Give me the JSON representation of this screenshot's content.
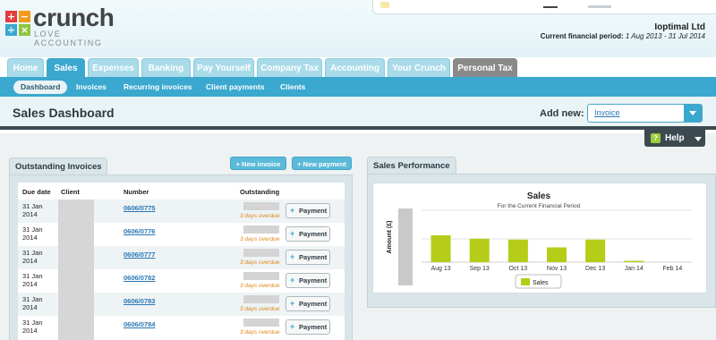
{
  "brand": {
    "logo_glyphs": [
      "+",
      "−",
      "÷",
      "×"
    ],
    "name": "crunch",
    "tagline": "LOVE ACCOUNTING",
    "colors": {
      "primary": "#3aa8cf",
      "red": "#e23c3c",
      "orange": "#f39a1d",
      "green": "#8cc63f"
    }
  },
  "account": {
    "company": "Ioptimal Ltd",
    "period_label": "Current financial period:",
    "period_value": "1 Aug 2013 - 31 Jul 2014"
  },
  "mainnav": {
    "tabs": [
      {
        "label": "Home"
      },
      {
        "label": "Sales",
        "active": true
      },
      {
        "label": "Expenses"
      },
      {
        "label": "Banking"
      },
      {
        "label": "Pay Yourself"
      },
      {
        "label": "Company Tax"
      },
      {
        "label": "Accounting"
      },
      {
        "label": "Your Crunch"
      },
      {
        "label": "Personal Tax"
      }
    ]
  },
  "subnav": {
    "items": [
      {
        "label": "Dashboard",
        "active": true
      },
      {
        "label": "Invoices"
      },
      {
        "label": "Recurring invoices"
      },
      {
        "label": "Client payments"
      },
      {
        "label": "Clients"
      }
    ]
  },
  "titlebar": {
    "title": "Sales Dashboard",
    "add_new_label": "Add new:",
    "add_new_value": "Invoice"
  },
  "help": {
    "icon": "?",
    "label": "Help"
  },
  "invoices": {
    "title": "Outstanding Invoices",
    "new_invoice": "+ New invoice",
    "new_payment": "+ New payment",
    "headers": {
      "due": "Due date",
      "client": "Client",
      "number": "Number",
      "outstanding": "Outstanding"
    },
    "payment_label": "Payment",
    "rows": [
      {
        "due": "31 Jan 2014",
        "number": "0606/0775",
        "overdue": "3 days overdue"
      },
      {
        "due": "31 Jan 2014",
        "number": "0606/0776",
        "overdue": "3 days overdue"
      },
      {
        "due": "31 Jan 2014",
        "number": "0606/0777",
        "overdue": "3 days overdue"
      },
      {
        "due": "31 Jan 2014",
        "number": "0606/0782",
        "overdue": "3 days overdue"
      },
      {
        "due": "31 Jan 2014",
        "number": "0606/0783",
        "overdue": "3 days overdue"
      },
      {
        "due": "31 Jan 2014",
        "number": "0606/0784",
        "overdue": "3 days overdue"
      }
    ]
  },
  "performance": {
    "title": "Sales Performance"
  },
  "chart_data": {
    "type": "bar",
    "title": "Sales",
    "subtitle": "For the Current Financial Period",
    "ylabel": "Amount (£)",
    "categories": [
      "Aug 13",
      "Sep 13",
      "Oct 13",
      "Nov 13",
      "Dec 13",
      "Jan 14",
      "Feb 14"
    ],
    "series": [
      {
        "name": "Sales",
        "values": [
          1.0,
          0.87,
          0.84,
          0.55,
          0.84,
          0.05,
          0
        ]
      }
    ],
    "y_scale": "relative (axis values hidden)",
    "bar_color": "#b5cc18",
    "grid": true,
    "legend_position": "bottom"
  }
}
